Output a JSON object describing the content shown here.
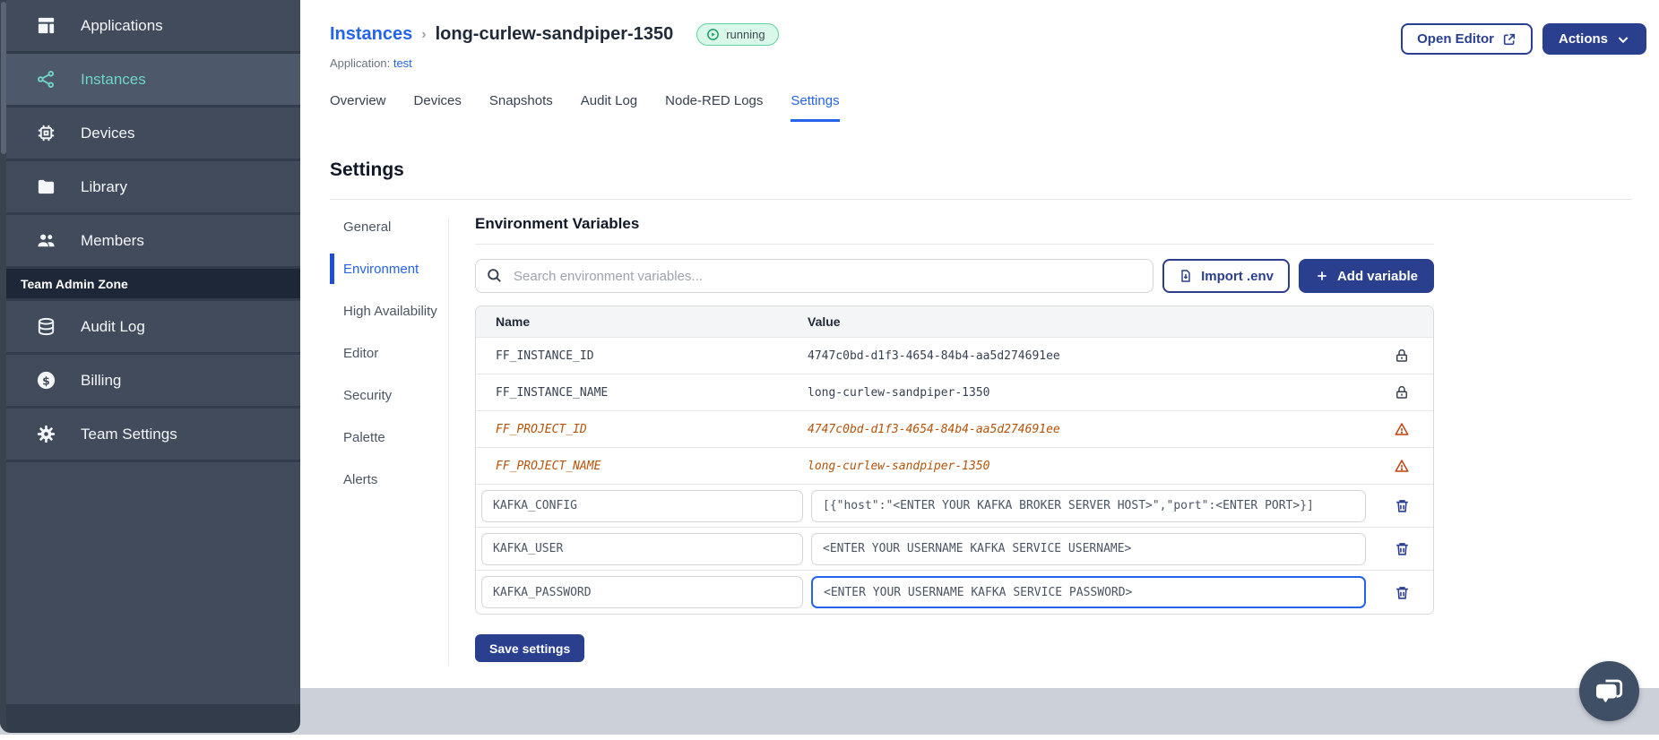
{
  "sidebar": {
    "items": [
      {
        "label": "Applications",
        "icon": "applications-icon"
      },
      {
        "label": "Instances",
        "icon": "instances-icon"
      },
      {
        "label": "Devices",
        "icon": "devices-icon"
      },
      {
        "label": "Library",
        "icon": "library-icon"
      },
      {
        "label": "Members",
        "icon": "members-icon"
      }
    ],
    "active_item": "Instances",
    "section_label": "Team Admin Zone",
    "admin_items": [
      {
        "label": "Audit Log",
        "icon": "audit-log-icon"
      },
      {
        "label": "Billing",
        "icon": "billing-icon"
      },
      {
        "label": "Team Settings",
        "icon": "team-settings-icon"
      }
    ]
  },
  "header": {
    "breadcrumb_parent": "Instances",
    "breadcrumb_separator": "›",
    "instance_name": "long-curlew-sandpiper-1350",
    "status": "running",
    "application_label": "Application:",
    "application_name": "test",
    "open_editor_label": "Open Editor",
    "actions_label": "Actions"
  },
  "tabs": {
    "items": [
      "Overview",
      "Devices",
      "Snapshots",
      "Audit Log",
      "Node-RED Logs",
      "Settings"
    ],
    "active": "Settings"
  },
  "settings": {
    "title": "Settings",
    "nav": [
      "General",
      "Environment",
      "High Availability",
      "Editor",
      "Security",
      "Palette",
      "Alerts"
    ],
    "active": "Environment"
  },
  "env": {
    "title": "Environment Variables",
    "search_placeholder": "Search environment variables...",
    "import_label": "Import .env",
    "add_label": "Add variable",
    "columns": {
      "name": "Name",
      "value": "Value"
    },
    "rows": [
      {
        "name": "FF_INSTANCE_ID",
        "value": "4747c0bd-d1f3-4654-84b4-aa5d274691ee",
        "state": "locked"
      },
      {
        "name": "FF_INSTANCE_NAME",
        "value": "long-curlew-sandpiper-1350",
        "state": "locked"
      },
      {
        "name": "FF_PROJECT_ID",
        "value": "4747c0bd-d1f3-4654-84b4-aa5d274691ee",
        "state": "deprecated"
      },
      {
        "name": "FF_PROJECT_NAME",
        "value": "long-curlew-sandpiper-1350",
        "state": "deprecated"
      },
      {
        "name": "KAFKA_CONFIG",
        "value": "[{\"host\":\"<ENTER YOUR KAFKA BROKER SERVER HOST>\",\"port\":<ENTER PORT>}]",
        "state": "editable"
      },
      {
        "name": "KAFKA_USER",
        "value": "<ENTER YOUR USERNAME KAFKA SERVICE USERNAME>",
        "state": "editable"
      },
      {
        "name": "KAFKA_PASSWORD",
        "value": "<ENTER YOUR USERNAME KAFKA SERVICE PASSWORD>",
        "state": "editable-focused"
      }
    ],
    "save_label": "Save settings"
  },
  "colors": {
    "accent_navy": "#2b3f8f",
    "link_blue": "#2563eb",
    "sidebar_bg": "#414b5c",
    "sidebar_active_teal": "#6fd5c8",
    "deprecated_orange": "#b45309",
    "running_green_border": "#5ed49c",
    "running_green_bg": "#daf8ea"
  }
}
